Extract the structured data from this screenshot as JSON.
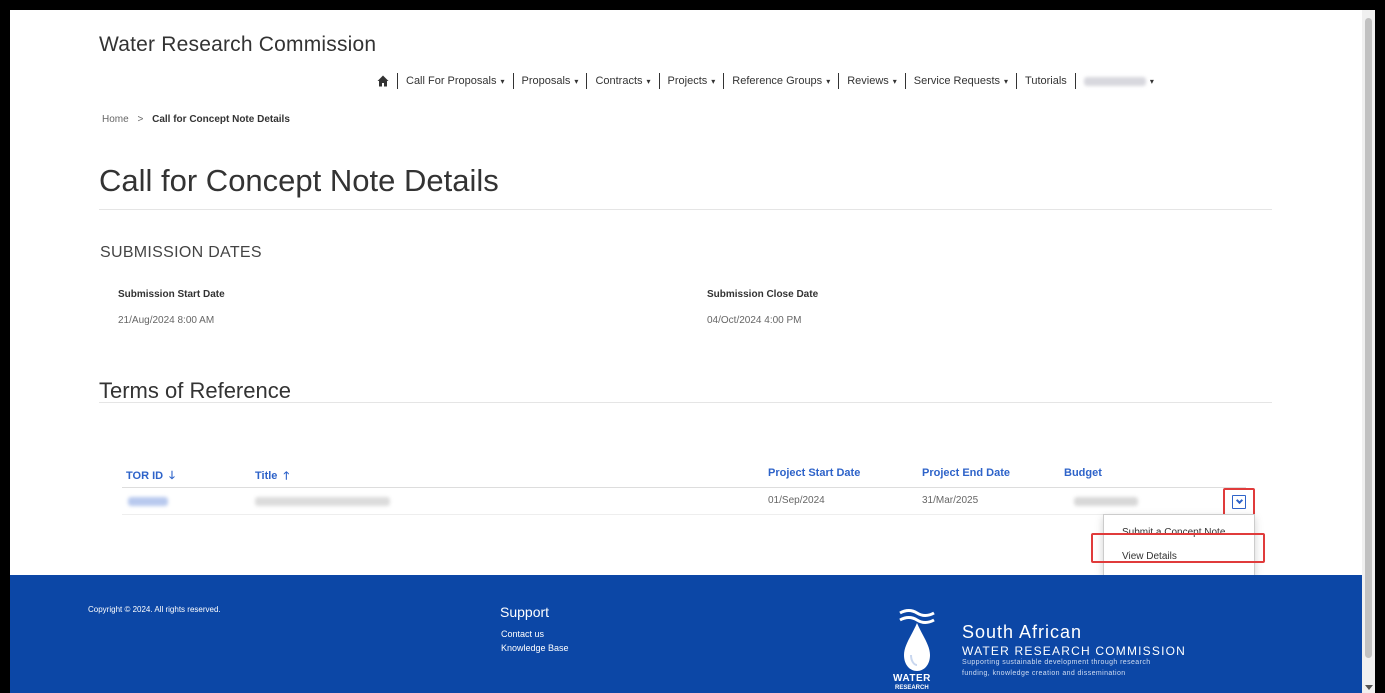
{
  "brand": "Water Research Commission",
  "nav": {
    "items": [
      {
        "label": "Call For Proposals",
        "caret": "▾"
      },
      {
        "label": "Proposals",
        "caret": "▾"
      },
      {
        "label": "Contracts",
        "caret": "▾"
      },
      {
        "label": "Projects",
        "caret": "▾"
      },
      {
        "label": "Reference Groups",
        "caret": "▾"
      },
      {
        "label": "Reviews",
        "caret": "▾"
      },
      {
        "label": "Service Requests",
        "caret": "▾"
      },
      {
        "label": "Tutorials",
        "caret": ""
      }
    ],
    "user_caret": "▾",
    "home_icon": "home-icon"
  },
  "breadcrumb": {
    "home": "Home",
    "separator": ">",
    "current": "Call for Concept Note Details"
  },
  "page_title": "Call for Concept Note Details",
  "submission": {
    "heading": "SUBMISSION DATES",
    "start_label": "Submission Start Date",
    "start_value": "21/Aug/2024 8:00 AM",
    "close_label": "Submission Close Date",
    "close_value": "04/Oct/2024 4:00 PM"
  },
  "tor": {
    "heading": "Terms of Reference",
    "columns": {
      "tor_id": "TOR ID",
      "tor_id_arrow": "🡓",
      "title": "Title",
      "title_arrow": "🡑",
      "start": "Project Start Date",
      "end": "Project End Date",
      "budget": "Budget"
    },
    "row": {
      "start": "01/Sep/2024",
      "end": "31/Mar/2025"
    },
    "menu": {
      "submit": "Submit a Concept Note",
      "view": "View Details"
    }
  },
  "footer": {
    "copyright": "Copyright © 2024. All rights reserved.",
    "support_heading": "Support",
    "contact": "Contact us",
    "kb": "Knowledge Base",
    "logo_line1": "South African",
    "logo_line2": "WATER RESEARCH COMMISSION",
    "logo_line3": "Supporting sustainable development through research",
    "logo_line4": "funding, knowledge creation and dissemination",
    "logo_word": "WATER",
    "logo_word2": "RESEARCH"
  },
  "colors": {
    "link": "#2e63c9",
    "footer": "#0c47a6",
    "highlight": "#e03b3b"
  }
}
